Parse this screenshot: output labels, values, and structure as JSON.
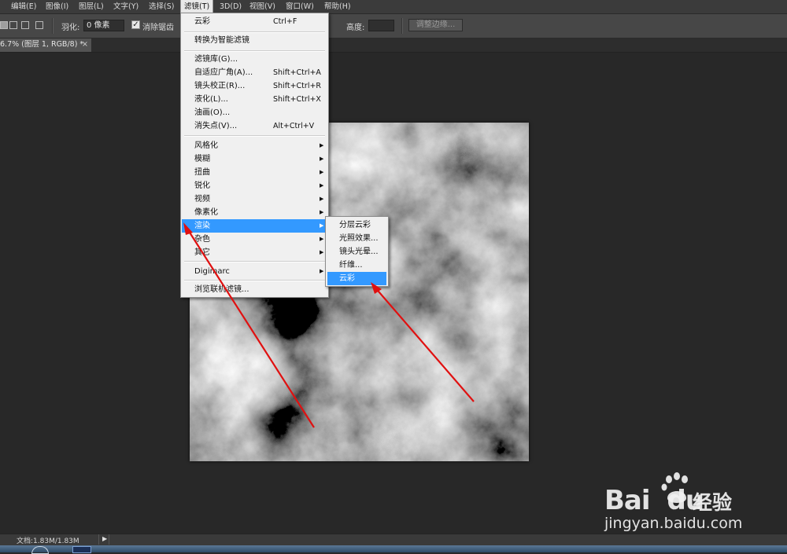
{
  "menubar": {
    "items": [
      "编辑(E)",
      "图像(I)",
      "图层(L)",
      "文字(Y)",
      "选择(S)",
      "滤镜(T)",
      "3D(D)",
      "视图(V)",
      "窗口(W)",
      "帮助(H)"
    ],
    "active_index": 5
  },
  "options_bar": {
    "feather_label": "羽化:",
    "feather_value": "0 像素",
    "antialias_label": "消除锯齿",
    "antialias_checked": true,
    "height_label": "高度:",
    "refine_edge_label": "调整边缘..."
  },
  "document_tab": {
    "title": "6.7% (图层 1, RGB/8) *",
    "close_glyph": "×"
  },
  "filter_menu": {
    "items": [
      {
        "label": "云彩",
        "shortcut": "Ctrl+F"
      },
      {
        "label": "转换为智能滤镜"
      },
      {
        "label": "滤镜库(G)..."
      },
      {
        "label": "自适应广角(A)...",
        "shortcut": "Shift+Ctrl+A"
      },
      {
        "label": "镜头校正(R)...",
        "shortcut": "Shift+Ctrl+R"
      },
      {
        "label": "液化(L)...",
        "shortcut": "Shift+Ctrl+X"
      },
      {
        "label": "油画(O)..."
      },
      {
        "label": "消失点(V)...",
        "shortcut": "Alt+Ctrl+V"
      },
      {
        "label": "风格化",
        "submenu": true
      },
      {
        "label": "模糊",
        "submenu": true
      },
      {
        "label": "扭曲",
        "submenu": true
      },
      {
        "label": "锐化",
        "submenu": true
      },
      {
        "label": "视频",
        "submenu": true
      },
      {
        "label": "像素化",
        "submenu": true
      },
      {
        "label": "渲染",
        "submenu": true,
        "highlighted": true
      },
      {
        "label": "杂色",
        "submenu": true
      },
      {
        "label": "其它",
        "submenu": true
      },
      {
        "label": "Digimarc",
        "submenu": true
      },
      {
        "label": "浏览联机滤镜..."
      }
    ]
  },
  "render_submenu": {
    "items": [
      {
        "label": "分层云彩"
      },
      {
        "label": "光照效果..."
      },
      {
        "label": "镜头光晕..."
      },
      {
        "label": "纤维..."
      },
      {
        "label": "云彩",
        "highlighted": true
      }
    ]
  },
  "status_bar": {
    "doc_info": "文档:1.83M/1.83M",
    "play_glyph": "▶"
  },
  "watermark": {
    "logo": "Bai",
    "logo_tail": "du",
    "brand_cn": "经验",
    "url": "jingyan.baidu.com"
  },
  "colors": {
    "menu_highlight": "#3399ff",
    "annotation_arrow": "#e01010",
    "workspace_bg": "#282828"
  }
}
